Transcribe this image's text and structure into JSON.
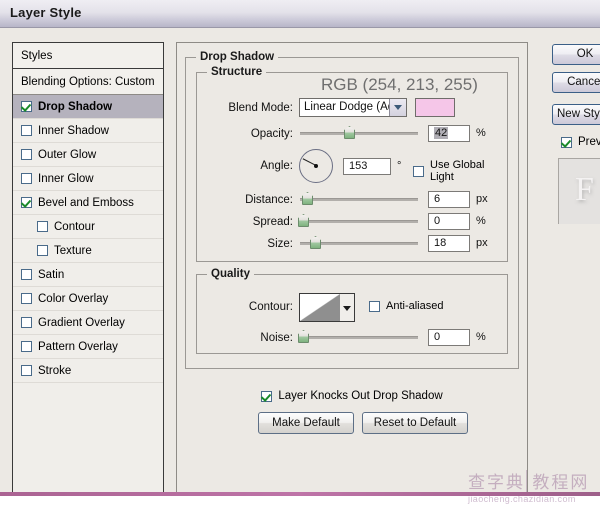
{
  "window": {
    "title": "Layer Style"
  },
  "styles_panel": {
    "header": "Styles",
    "blending_options": "Blending Options: Custom",
    "items": [
      {
        "label": "Drop Shadow",
        "checked": true,
        "selected": true,
        "indent": false
      },
      {
        "label": "Inner Shadow",
        "checked": false,
        "selected": false,
        "indent": false
      },
      {
        "label": "Outer Glow",
        "checked": false,
        "selected": false,
        "indent": false
      },
      {
        "label": "Inner Glow",
        "checked": false,
        "selected": false,
        "indent": false
      },
      {
        "label": "Bevel and Emboss",
        "checked": true,
        "selected": false,
        "indent": false
      },
      {
        "label": "Contour",
        "checked": false,
        "selected": false,
        "indent": true
      },
      {
        "label": "Texture",
        "checked": false,
        "selected": false,
        "indent": true
      },
      {
        "label": "Satin",
        "checked": false,
        "selected": false,
        "indent": false
      },
      {
        "label": "Color Overlay",
        "checked": false,
        "selected": false,
        "indent": false
      },
      {
        "label": "Gradient Overlay",
        "checked": false,
        "selected": false,
        "indent": false
      },
      {
        "label": "Pattern Overlay",
        "checked": false,
        "selected": false,
        "indent": false
      },
      {
        "label": "Stroke",
        "checked": false,
        "selected": false,
        "indent": false
      }
    ]
  },
  "main": {
    "section_title": "Drop Shadow",
    "structure": {
      "title": "Structure",
      "blend_mode_label": "Blend Mode:",
      "blend_mode_value": "Linear Dodge (Add)",
      "color_swatch_hex": "#f5c6e8",
      "rgb_note": "RGB (254, 213, 255)",
      "opacity_label": "Opacity:",
      "opacity_value": "42",
      "opacity_unit": "%",
      "angle_label": "Angle:",
      "angle_value": "153",
      "angle_unit": "°",
      "use_global_light_label": "Use Global Light",
      "use_global_light_checked": false,
      "distance_label": "Distance:",
      "distance_value": "6",
      "distance_unit": "px",
      "spread_label": "Spread:",
      "spread_value": "0",
      "spread_unit": "%",
      "size_label": "Size:",
      "size_value": "18",
      "size_unit": "px"
    },
    "quality": {
      "title": "Quality",
      "contour_label": "Contour:",
      "anti_aliased_label": "Anti-aliased",
      "anti_aliased_checked": false,
      "noise_label": "Noise:",
      "noise_value": "0",
      "noise_unit": "%"
    },
    "knockout_label": "Layer Knocks Out Drop Shadow",
    "knockout_checked": true,
    "make_default_label": "Make Default",
    "reset_default_label": "Reset to Default"
  },
  "right": {
    "ok_label": "OK",
    "cancel_label": "Cancel",
    "new_style_label": "New Style...",
    "preview_label": "Preview",
    "preview_checked": true,
    "preview_glyph": "F"
  },
  "watermark": {
    "cn": "查字典 教程网",
    "en": "jiaocheng.chazidian.com"
  }
}
